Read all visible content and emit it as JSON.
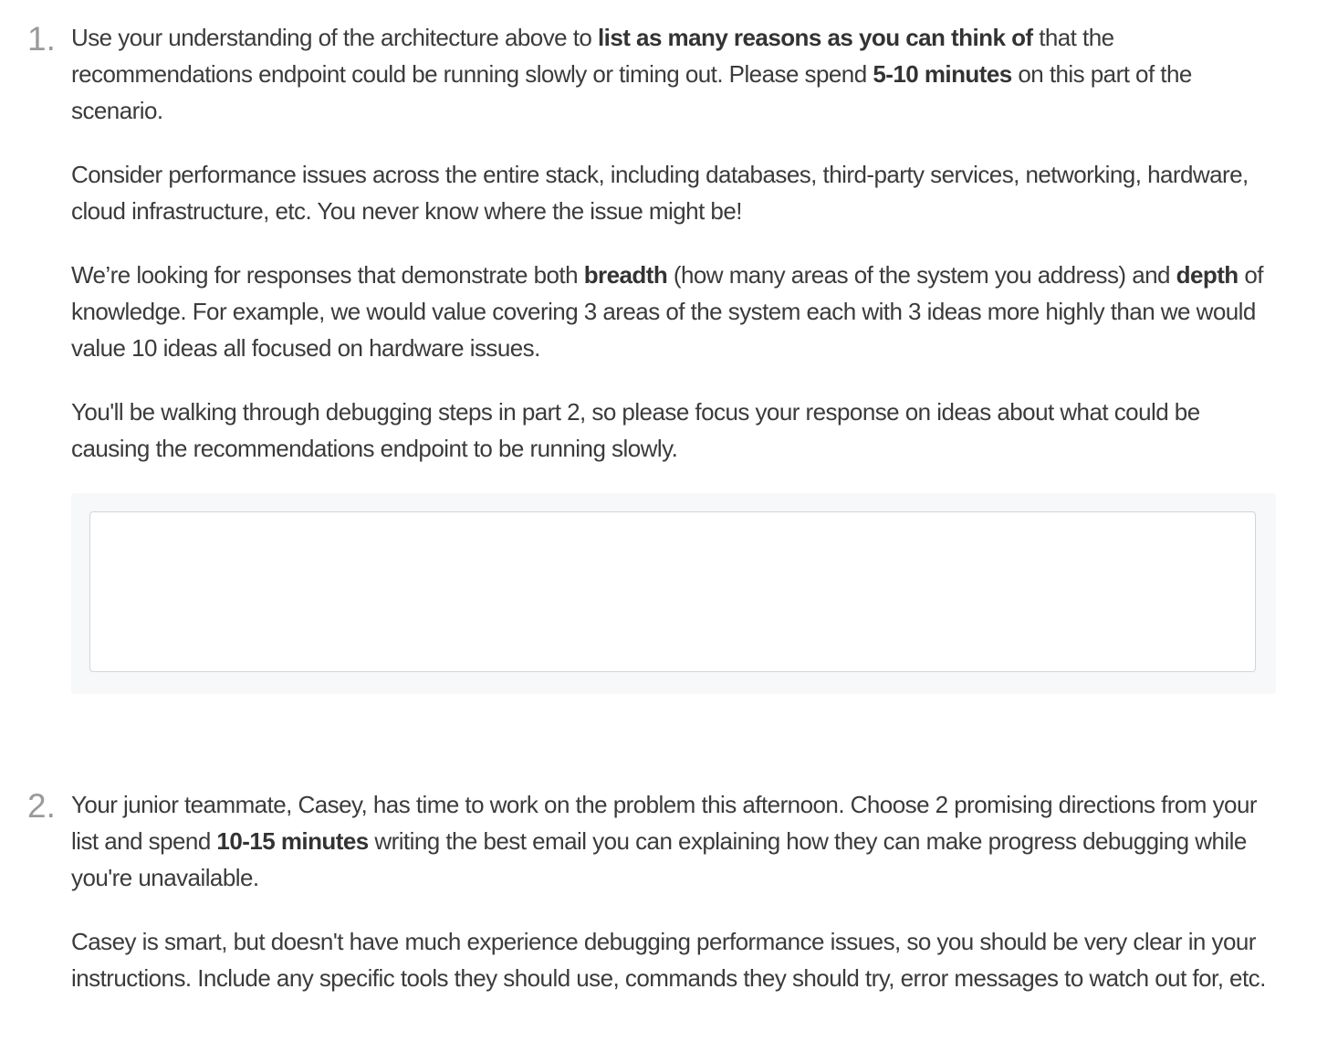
{
  "questions": [
    {
      "number": "1.",
      "paragraphs": [
        [
          {
            "t": "Use your understanding of the architecture above to ",
            "b": false
          },
          {
            "t": "list as many reasons as you can think of",
            "b": true
          },
          {
            "t": " that the recommendations endpoint could be running slowly or timing out. Please spend ",
            "b": false
          },
          {
            "t": "5-10 minutes",
            "b": true
          },
          {
            "t": " on this part of the scenario.",
            "b": false
          }
        ],
        [
          {
            "t": "Consider performance issues across the entire stack, including databases, third-party services, networking, hardware, cloud infrastructure, etc. You never know where the issue might be!",
            "b": false
          }
        ],
        [
          {
            "t": "We’re looking for responses that demonstrate both ",
            "b": false
          },
          {
            "t": "breadth",
            "b": true
          },
          {
            "t": " (how many areas of the system you address) and ",
            "b": false
          },
          {
            "t": "depth",
            "b": true
          },
          {
            "t": " of knowledge. For example, we would value covering 3 areas of the system each with 3 ideas more highly than we would value 10 ideas all focused on hardware issues.",
            "b": false
          }
        ],
        [
          {
            "t": "You'll be walking through debugging steps in part 2, so please focus your response on ideas about what could be causing the recommendations endpoint to be running slowly.",
            "b": false
          }
        ]
      ],
      "answer": {
        "value": "",
        "placeholder": ""
      }
    },
    {
      "number": "2.",
      "paragraphs": [
        [
          {
            "t": "Your junior teammate, Casey, has time to work on the problem this afternoon. Choose 2 promising directions from your list and spend ",
            "b": false
          },
          {
            "t": "10-15 minutes",
            "b": true
          },
          {
            "t": " writing the best email you can explaining how they can make progress debugging while you're unavailable.",
            "b": false
          }
        ],
        [
          {
            "t": "Casey is smart, but doesn't have much experience debugging performance issues, so you should be very clear in your instructions. Include any specific tools they should use, commands they should try, error messages to watch out for, etc.",
            "b": false
          }
        ]
      ]
    }
  ]
}
